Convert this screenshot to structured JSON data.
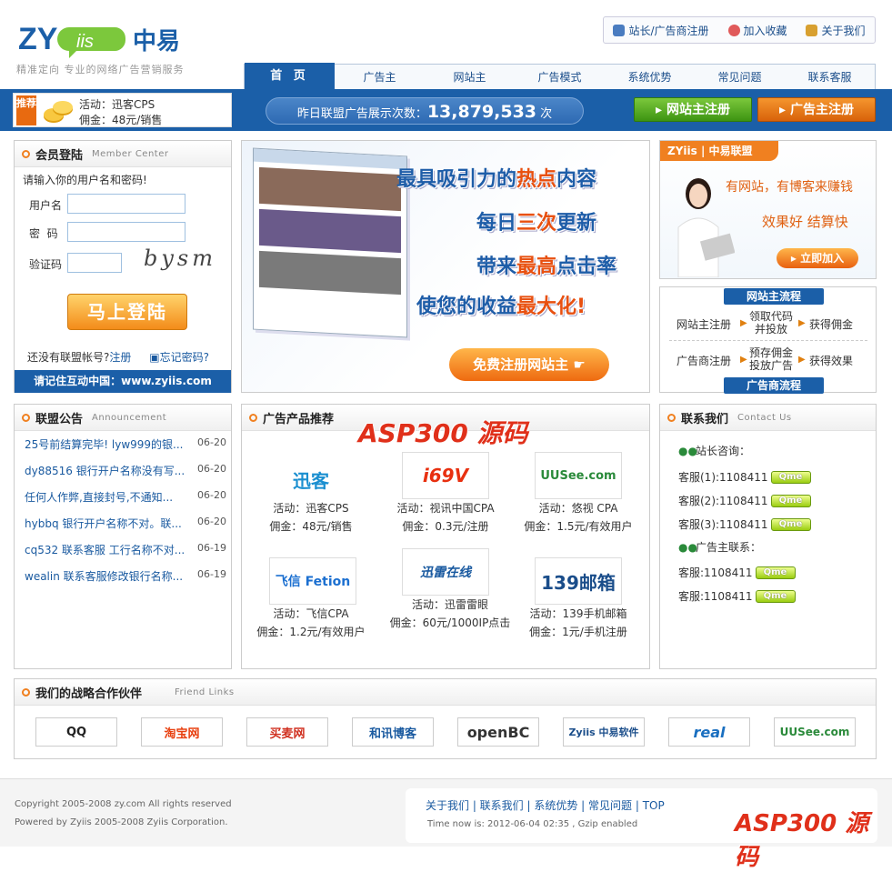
{
  "header": {
    "logo_text": "ZYiis",
    "logo_cn": "中易",
    "slogan": "精准定向  专业的网络广告营销服务",
    "toplinks": [
      "站长/广告商注册",
      "加入收藏",
      "关于我们"
    ],
    "nav": [
      "首 页",
      "广告主",
      "网站主",
      "广告模式",
      "系统优势",
      "常见问题",
      "联系客服"
    ]
  },
  "promo": {
    "tag": "推荐",
    "line1": "活动：迅客CPS",
    "line2": "佣金：48元/销售"
  },
  "stats": {
    "label": "昨日联盟广告展示次数：",
    "value": "13,879,533",
    "unit": "次"
  },
  "reg": {
    "site": "网站主注册",
    "adv": "广告主注册"
  },
  "login": {
    "title": "会员登陆",
    "title_en": "Member Center",
    "prompt": "请输入你的用户名和密码!",
    "username_label": "用户名",
    "password_label": "密  码",
    "captcha_label": "验证码",
    "captcha": "bysm",
    "button": "马上登陆",
    "no_account": "还没有联盟帐号?",
    "register": "注册",
    "forgot": "忘记密码?",
    "remember": "请记住互动中国：www.zyiis.com"
  },
  "banner": {
    "line1a": "最具吸引力的",
    "line1b": "热点",
    "line1c": "内容",
    "line2a": "每日",
    "line2b": "三次",
    "line2c": "更新",
    "line3a": "带来",
    "line3b": "最高",
    "line3c": "点击率",
    "line4a": "使您的收益",
    "line4b": "最大化!",
    "cta": "免费注册网站主"
  },
  "rightad": {
    "head": "ZYiis | 中易联盟",
    "t1": "有网站，有博客来赚钱",
    "t2": "效果好 结算快",
    "button": "立即加入"
  },
  "flow": {
    "site_title": "网站主流程",
    "site_steps": [
      "网站主注册",
      "领取代码\n并投放",
      "获得佣金"
    ],
    "adv_steps": [
      "广告商注册",
      "预存佣金\n投放广告",
      "获得效果"
    ],
    "adv_title": "广告商流程"
  },
  "announce": {
    "title": "联盟公告",
    "title_en": "Announcement",
    "items": [
      {
        "text": "25号前结算完毕! lyw999的银...",
        "date": "06-20"
      },
      {
        "text": "dy88516 银行开户名称没有写...",
        "date": "06-20"
      },
      {
        "text": "任何人作弊,直接封号,不通知...",
        "date": "06-20"
      },
      {
        "text": "hybbq 银行开户名称不对。联...",
        "date": "06-20"
      },
      {
        "text": "cq532 联系客服  工行名称不对...",
        "date": "06-19"
      },
      {
        "text": "wealin 联系客服修改银行名称...",
        "date": "06-19"
      }
    ]
  },
  "products": {
    "title": "广告产品推荐",
    "items": [
      {
        "logo": "迅客",
        "act": "活动：迅客CPS",
        "fee": "佣金：48元/销售"
      },
      {
        "logo": "i69V",
        "act": "活动：视讯中国CPA",
        "fee": "佣金：0.3元/注册"
      },
      {
        "logo": "UUSee.com",
        "act": "活动：悠视  CPA",
        "fee": "佣金：1.5元/有效用户"
      },
      {
        "logo": "飞信 Fetion",
        "act": "活动：飞信CPA",
        "fee": "佣金：1.2元/有效用户"
      },
      {
        "logo": "迅雷在线",
        "act": "活动：迅雷雷眼",
        "fee": "佣金：60元/1000IP点击"
      },
      {
        "logo": "139邮箱",
        "act": "活动：139手机邮箱",
        "fee": "佣金：1元/手机注册"
      }
    ]
  },
  "contact": {
    "title": "联系我们",
    "title_en": "Contact Us",
    "site_label": "站长咨询：",
    "site": [
      "客服(1):1108411",
      "客服(2):1108411",
      "客服(3):1108411"
    ],
    "adv_label": "广告主联系：",
    "adv": [
      "客服:1108411",
      "客服:1108411"
    ],
    "qme": "Qme"
  },
  "partners": {
    "title": "我们的战略合作伙伴",
    "title_en": "Friend Links",
    "items": [
      "QQ",
      "淘宝网",
      "买麦网",
      "和讯博客",
      "openBC",
      "Zyiis 中易软件",
      "real",
      "UUSee.com"
    ]
  },
  "footer": {
    "copyright": "Copyright 2005-2008 zy.com All rights reserved",
    "powered": "Powered by Zyiis 2005-2008 Zyiis Corporation.",
    "links": "关于我们 | 联系我们 | 系统优势 | 常见问题 | TOP",
    "time": "Time now is: 2012-06-04 02:35 , Gzip enabled"
  },
  "watermark": "ASP300 源码"
}
